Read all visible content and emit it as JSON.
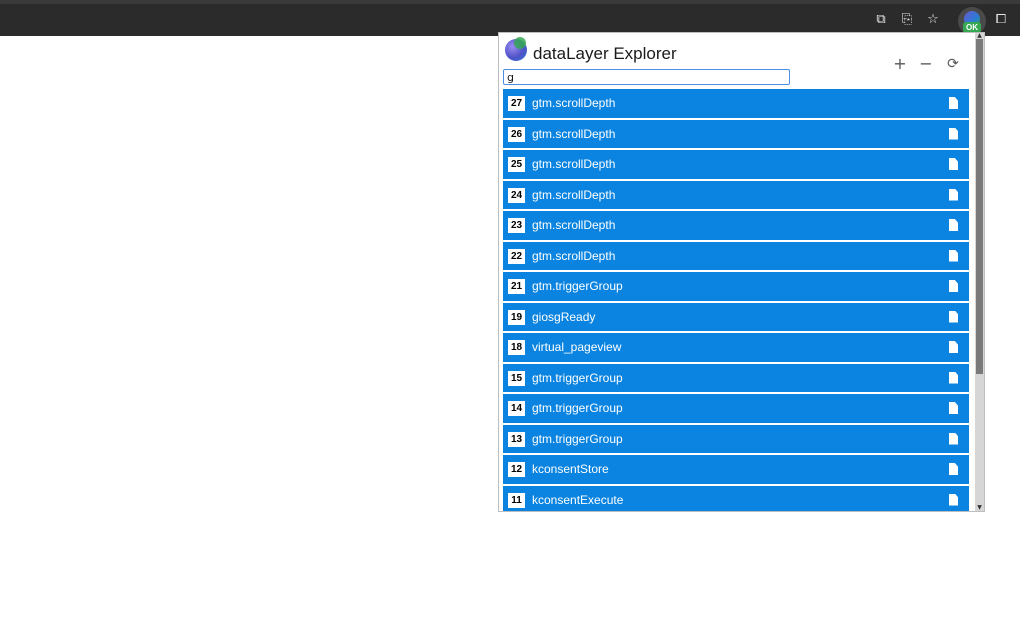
{
  "toolbar": {
    "icons": [
      "cast-icon",
      "translate-icon",
      "star-icon",
      "extension-icon",
      "puzzle-icon"
    ],
    "extension_badge": "OK"
  },
  "popup": {
    "title": "dataLayer Explorer",
    "search": {
      "value": "g",
      "placeholder": ""
    },
    "controls": {
      "expand": "+",
      "collapse": "−",
      "refresh": "⟳"
    },
    "events": [
      {
        "num": "27",
        "name": "gtm.scrollDepth"
      },
      {
        "num": "26",
        "name": "gtm.scrollDepth"
      },
      {
        "num": "25",
        "name": "gtm.scrollDepth"
      },
      {
        "num": "24",
        "name": "gtm.scrollDepth"
      },
      {
        "num": "23",
        "name": "gtm.scrollDepth"
      },
      {
        "num": "22",
        "name": "gtm.scrollDepth"
      },
      {
        "num": "21",
        "name": "gtm.triggerGroup"
      },
      {
        "num": "19",
        "name": "giosgReady"
      },
      {
        "num": "18",
        "name": "virtual_pageview"
      },
      {
        "num": "15",
        "name": "gtm.triggerGroup"
      },
      {
        "num": "14",
        "name": "gtm.triggerGroup"
      },
      {
        "num": "13",
        "name": "gtm.triggerGroup"
      },
      {
        "num": "12",
        "name": "kconsentStore"
      },
      {
        "num": "11",
        "name": "kconsentExecute"
      }
    ]
  },
  "colors": {
    "row_bg": "#0a84e0",
    "accent": "#34a853"
  }
}
